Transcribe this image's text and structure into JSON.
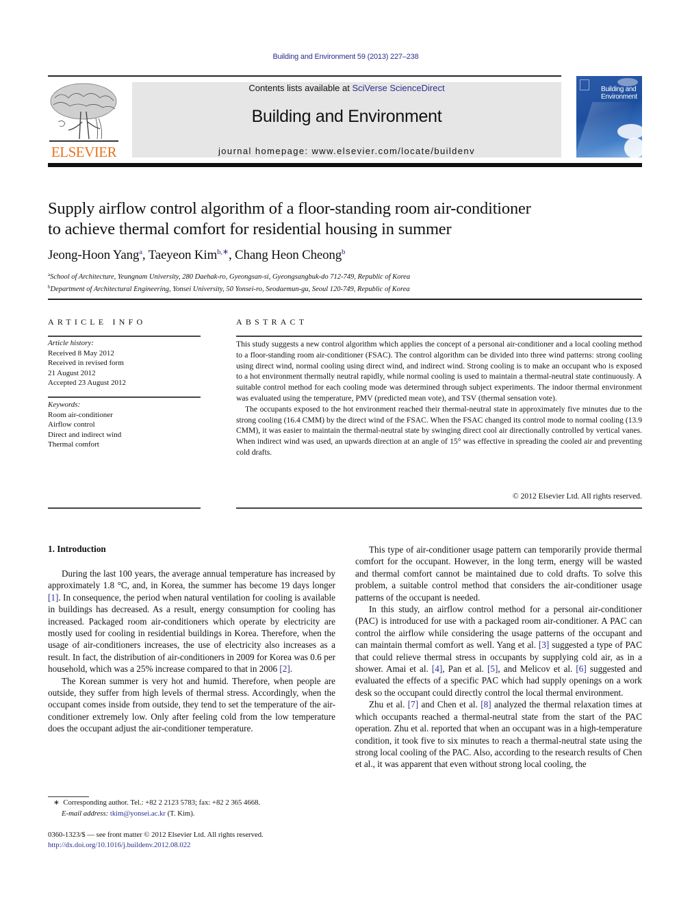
{
  "header": {
    "journal_ref": "Building and Environment 59 (2013) 227–238",
    "contents_prefix": "Contents lists available at ",
    "contents_link": "SciVerse ScienceDirect",
    "journal_title": "Building and Environment",
    "homepage": "journal homepage: www.elsevier.com/locate/buildenv",
    "publisher_logo_text": "ELSEVIER",
    "cover_title_line1": "Building and",
    "cover_title_line2": "Environment"
  },
  "colors": {
    "link": "#2a2f8f",
    "elsevier_orange": "#e8731b",
    "banner_bg": "#e6e6e6",
    "cover_blue": "#1e4f9e"
  },
  "article": {
    "title_line1": "Supply airflow control algorithm of a floor-standing room air-conditioner",
    "title_line2": "to achieve thermal comfort for residential housing in summer",
    "authors": [
      {
        "name": "Jeong-Hoon Yang",
        "sup": "a"
      },
      {
        "name": "Taeyeon Kim",
        "sup": "b,∗"
      },
      {
        "name": "Chang Heon Cheong",
        "sup": "b"
      }
    ],
    "affiliations": [
      {
        "sup": "a",
        "text": "School of Architecture, Yeungnam University, 280 Daehak-ro, Gyeongsan-si, Gyeongsangbuk-do 712-749, Republic of Korea"
      },
      {
        "sup": "b",
        "text": "Department of Architectural Engineering, Yonsei University, 50 Yonsei-ro, Seodaemun-gu, Seoul 120-749, Republic of Korea"
      }
    ]
  },
  "article_info": {
    "heading": "ARTICLE INFO",
    "history_label": "Article history:",
    "history": [
      "Received 8 May 2012",
      "Received in revised form",
      "21 August 2012",
      "Accepted 23 August 2012"
    ],
    "keywords_label": "Keywords:",
    "keywords": [
      "Room air-conditioner",
      "Airflow control",
      "Direct and indirect wind",
      "Thermal comfort"
    ]
  },
  "abstract": {
    "heading": "ABSTRACT",
    "p1": "This study suggests a new control algorithm which applies the concept of a personal air-conditioner and a local cooling method to a floor-standing room air-conditioner (FSAC). The control algorithm can be divided into three wind patterns: strong cooling using direct wind, normal cooling using direct wind, and indirect wind. Strong cooling is to make an occupant who is exposed to a hot environment thermally neutral rapidly, while normal cooling is used to maintain a thermal-neutral state continuously. A suitable control method for each cooling mode was determined through subject experiments. The indoor thermal environment was evaluated using the temperature, PMV (predicted mean vote), and TSV (thermal sensation vote).",
    "p2": "The occupants exposed to the hot environment reached their thermal-neutral state in approximately five minutes due to the strong cooling (16.4 CMM) by the direct wind of the FSAC. When the FSAC changed its control mode to normal cooling (13.9 CMM), it was easier to maintain the thermal-neutral state by swinging direct cool air directionally controlled by vertical vanes. When indirect wind was used, an upwards direction at an angle of 15° was effective in spreading the cooled air and preventing cold drafts.",
    "copyright": "© 2012 Elsevier Ltd. All rights reserved."
  },
  "body": {
    "section_heading": "1.  Introduction",
    "left": {
      "p1_a": "During the last 100 years, the average annual temperature has increased by approximately 1.8 °C, and, in Korea, the summer has become 19 days longer ",
      "p1_ref1": "[1]",
      "p1_b": ". In consequence, the period when natural ventilation for cooling is available in buildings has decreased. As a result, energy consumption for cooling has increased. Packaged room air-conditioners which operate by electricity are mostly used for cooling in residential buildings in Korea. Therefore, when the usage of air-conditioners increases, the use of electricity also increases as a result. In fact, the distribution of air-conditioners in 2009 for Korea was 0.6 per household, which was a 25% increase compared to that in 2006 ",
      "p1_ref2": "[2]",
      "p1_c": ".",
      "p2": "The Korean summer is very hot and humid. Therefore, when people are outside, they suffer from high levels of thermal stress. Accordingly, when the occupant comes inside from outside, they tend to set the temperature of the air-conditioner extremely low. Only after feeling cold from the low temperature does the occupant adjust the air-conditioner temperature."
    },
    "right": {
      "p1": "This type of air-conditioner usage pattern can temporarily provide thermal comfort for the occupant. However, in the long term, energy will be wasted and thermal comfort cannot be maintained due to cold drafts. To solve this problem, a suitable control method that considers the air-conditioner usage patterns of the occupant is needed.",
      "p2_a": "In this study, an airflow control method for a personal air-conditioner (PAC) is introduced for use with a packaged room air-conditioner. A PAC can control the airflow while considering the usage patterns of the occupant and can maintain thermal comfort as well. Yang et al. ",
      "p2_ref3": "[3]",
      "p2_b": " suggested a type of PAC that could relieve thermal stress in occupants by supplying cold air, as in a shower. Amai et al. ",
      "p2_ref4": "[4]",
      "p2_c": ", Pan et al. ",
      "p2_ref5": "[5]",
      "p2_d": ", and Melicov et al. ",
      "p2_ref6": "[6]",
      "p2_e": " suggested and evaluated the effects of a specific PAC which had supply openings on a work desk so the occupant could directly control the local thermal environment.",
      "p3_a": "Zhu et al. ",
      "p3_ref7": "[7]",
      "p3_b": " and Chen et al. ",
      "p3_ref8": "[8]",
      "p3_c": " analyzed the thermal relaxation times at which occupants reached a thermal-neutral state from the start of the PAC operation. Zhu et al. reported that when an occupant was in a high-temperature condition, it took five to six minutes to reach a thermal-neutral state using the strong local cooling of the PAC. Also, according to the research results of Chen et al., it was apparent that even without strong local cooling, the"
    }
  },
  "footnote": {
    "star": "∗",
    "corresponding": "Corresponding author. Tel.: +82 2 2123 5783; fax: +82 2 365 4668.",
    "email_label": "E-mail address:",
    "email": "tkim@yonsei.ac.kr",
    "email_suffix": " (T. Kim)."
  },
  "front_matter": {
    "issn_line": "0360-1323/$ — see front matter © 2012 Elsevier Ltd. All rights reserved.",
    "doi": "http://dx.doi.org/10.1016/j.buildenv.2012.08.022"
  }
}
